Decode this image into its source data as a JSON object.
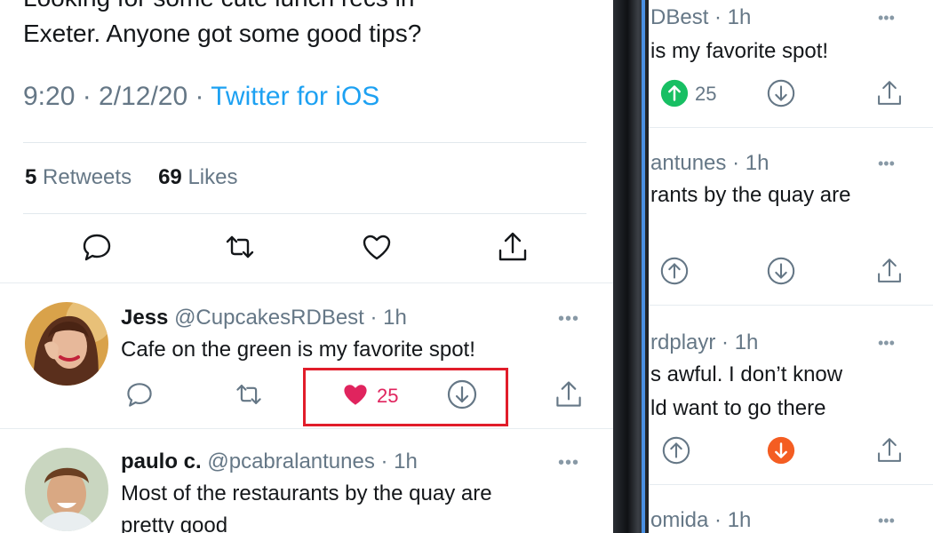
{
  "main_tweet": {
    "text_line1": "Looking for some cute lunch recs in",
    "text_line2": "Exeter. Anyone got some good tips?",
    "time": "9:20 · 2/12/20 · ",
    "source": "Twitter for iOS",
    "retweets_count": "5",
    "retweets_label": "Retweets",
    "likes_count": "69",
    "likes_label": "Likes"
  },
  "replies": [
    {
      "name": "Jess",
      "handle": "@CupcakesRDBest",
      "time": "· 1h",
      "text": "Cafe on the green is my favorite spot!",
      "upvotes": "25",
      "vote_state": "liked"
    },
    {
      "name": "paulo c.",
      "handle": "@pcabralantunes",
      "time": "· 1h",
      "text_line1": "Most of the restaurants by the quay are",
      "text_line2": "pretty good"
    }
  ],
  "right_panel": {
    "item1": {
      "header": "DBest · 1h",
      "text": "is my favorite spot!",
      "upvotes": "25",
      "vote_state": "up"
    },
    "item2": {
      "header": "antunes · 1h",
      "text": "rants by the quay are"
    },
    "item3": {
      "header": "rdplayr · 1h",
      "text_line1": "s awful. I don’t know",
      "text_line2": "ld want to go there",
      "vote_state": "down"
    },
    "item4": {
      "header": "omida · 1h"
    }
  },
  "dots": "•••",
  "colors": {
    "accent_blue": "#1da1f2",
    "like_pink": "#e0245e",
    "upvote_green": "#17bf63",
    "downvote_orange": "#f45d22",
    "highlight_red": "#e11d2a"
  },
  "icons": [
    "reply-icon",
    "retweet-icon",
    "like-icon",
    "share-icon",
    "heart-filled-icon",
    "downvote-icon",
    "upvote-icon",
    "more-dots-icon"
  ]
}
